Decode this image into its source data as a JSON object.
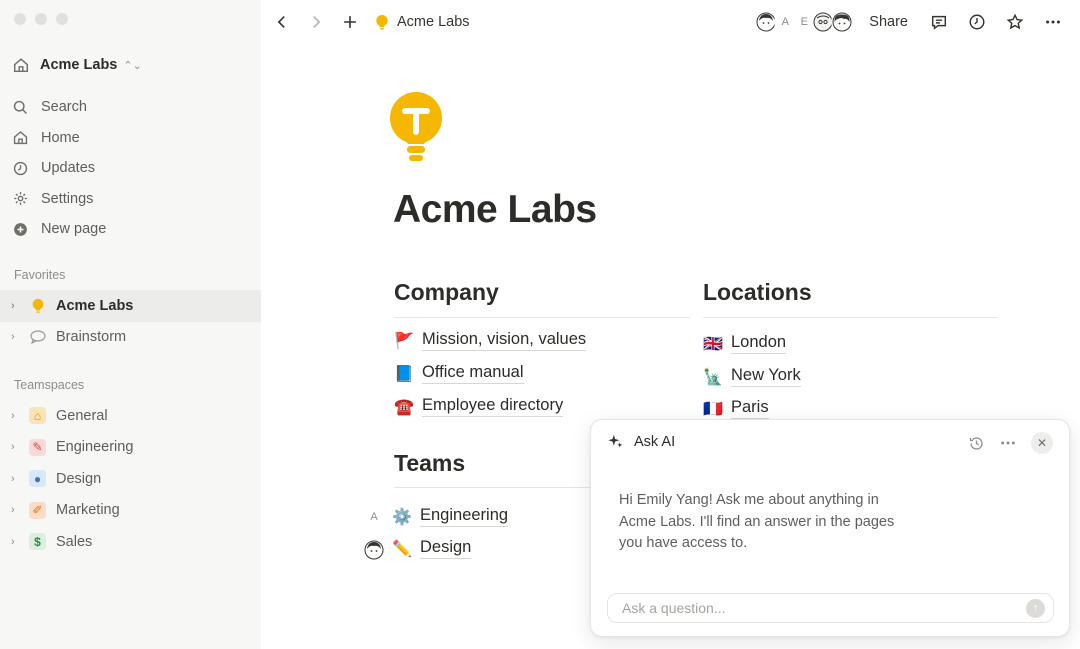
{
  "window": {
    "title": "Acme Labs"
  },
  "sidebar": {
    "workspace_name": "Acme Labs",
    "nav": [
      {
        "label": "Search",
        "icon": "search-icon"
      },
      {
        "label": "Home",
        "icon": "home-icon"
      },
      {
        "label": "Updates",
        "icon": "clock-icon"
      },
      {
        "label": "Settings",
        "icon": "gear-icon"
      },
      {
        "label": "New page",
        "icon": "plus-circle-icon"
      }
    ],
    "favorites_label": "Favorites",
    "favorites": [
      {
        "label": "Acme Labs",
        "icon": "lightbulb-icon"
      },
      {
        "label": "Brainstorm",
        "icon": "speech-bubble-icon"
      }
    ],
    "teamspaces_label": "Teamspaces",
    "teamspaces": [
      {
        "label": "General",
        "icon": "house-icon",
        "color": "#f9e4b7"
      },
      {
        "label": "Engineering",
        "icon": "wrench-icon",
        "color": "#fbd9d6"
      },
      {
        "label": "Design",
        "icon": "palette-icon",
        "color": "#d8e8f8"
      },
      {
        "label": "Marketing",
        "icon": "pencil-icon",
        "color": "#fbdcc8"
      },
      {
        "label": "Sales",
        "icon": "dollar-icon",
        "color": "#dcefdc"
      }
    ]
  },
  "topbar": {
    "breadcrumb": "Acme Labs",
    "avatars": [
      "A",
      "E"
    ],
    "share_label": "Share"
  },
  "page": {
    "title": "Acme Labs",
    "company": {
      "heading": "Company",
      "links": [
        {
          "emoji": "🚩",
          "label": "Mission, vision, values"
        },
        {
          "emoji": "📘",
          "label": "Office manual"
        },
        {
          "emoji": "☎️",
          "label": "Employee directory"
        }
      ]
    },
    "locations": {
      "heading": "Locations",
      "links": [
        {
          "emoji": "🇬🇧",
          "label": "London"
        },
        {
          "emoji": "🗽",
          "label": "New York"
        },
        {
          "emoji": "🇫🇷",
          "label": "Paris"
        }
      ]
    },
    "teams": {
      "heading": "Teams",
      "links": [
        {
          "emoji": "⚙️",
          "label": "Engineering",
          "avatar": "A"
        },
        {
          "emoji": "✏️",
          "label": "Design",
          "avatar": ""
        }
      ]
    }
  },
  "ai_panel": {
    "title": "Ask AI",
    "message": "Hi Emily Yang! Ask me about anything in Acme Labs. I'll find an answer in the pages you have access to.",
    "input_placeholder": "Ask a question..."
  },
  "colors": {
    "sidebar_bg": "#f7f7f5",
    "text": "#37352f",
    "accent_yellow": "#f5b700"
  }
}
